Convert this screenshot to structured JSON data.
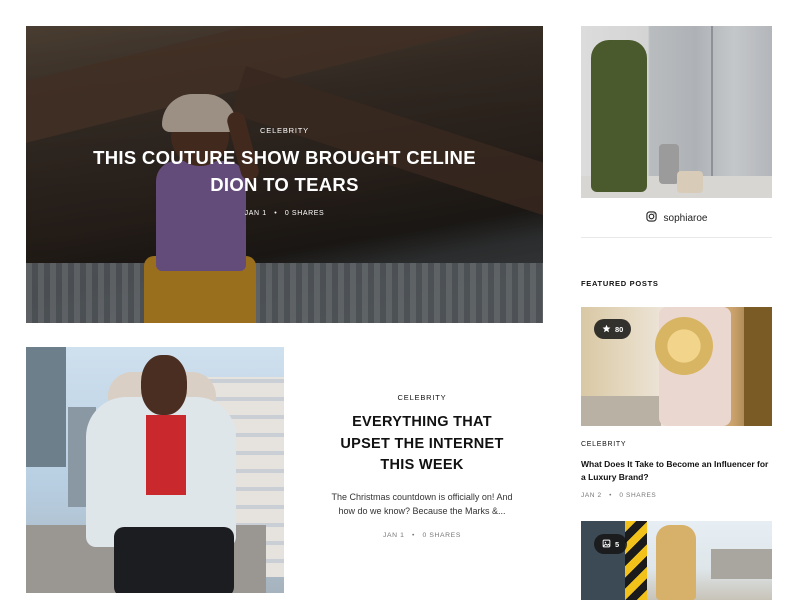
{
  "hero": {
    "category": "CELEBRITY",
    "title": "THIS COUTURE SHOW BROUGHT CELINE DION TO TEARS",
    "date": "JAN 1",
    "shares": "0 SHARES"
  },
  "post2": {
    "category": "CELEBRITY",
    "title": "EVERYTHING THAT UPSET THE INTERNET THIS WEEK",
    "excerpt": "The Christmas countdown is officially on! And how do we know? Because the Marks &...",
    "date": "JAN 1",
    "shares": "0 SHARES"
  },
  "sidebar": {
    "instagram": {
      "icon": "instagram-icon",
      "username": "sophiaroe"
    },
    "featured_label": "FEATURED POSTS",
    "featured": [
      {
        "badge_icon": "star-icon",
        "badge_count": "80",
        "category": "CELEBRITY",
        "title": "What Does It Take to Become an Influencer for a Luxury Brand?",
        "date": "JAN 2",
        "shares": "0 SHARES"
      },
      {
        "badge_icon": "gallery-icon",
        "badge_count": "5"
      }
    ]
  }
}
